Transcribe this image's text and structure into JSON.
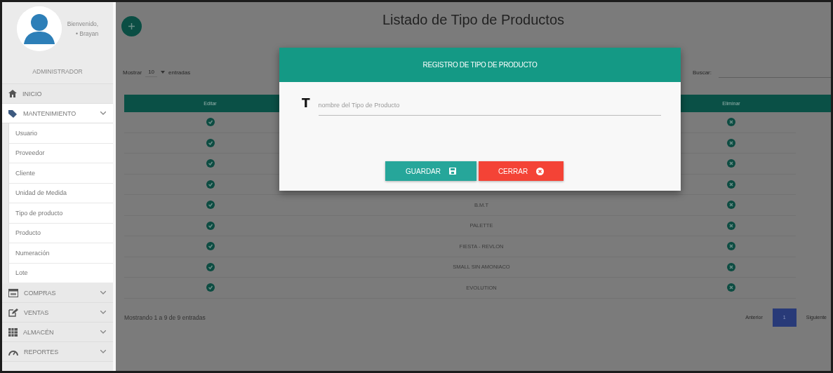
{
  "sidebar": {
    "greeting": "Bienvenido,",
    "user": "• Brayan",
    "role": "ADMINISTRADOR",
    "menu": [
      {
        "kind": "home",
        "label": "INICIO",
        "expanded": false
      },
      {
        "kind": "group",
        "label": "MANTENIMIENTO",
        "expanded": true,
        "children": [
          {
            "label": "Usuario"
          },
          {
            "label": "Proveedor"
          },
          {
            "label": "Cliente"
          },
          {
            "label": "Unidad de Medida"
          },
          {
            "label": "Tipo de producto"
          },
          {
            "label": "Producto"
          },
          {
            "label": "Numeración"
          },
          {
            "label": "Lote"
          }
        ]
      },
      {
        "kind": "group",
        "label": "COMPRAS",
        "expanded": false
      },
      {
        "kind": "group",
        "label": "VENTAS",
        "expanded": false
      },
      {
        "kind": "group",
        "label": "ALMACÉN",
        "expanded": false
      },
      {
        "kind": "group",
        "label": "REPORTES",
        "expanded": false
      }
    ]
  },
  "main": {
    "title": "Listado de Tipo de Productos",
    "length_label": "Mostrar",
    "length_value": "10",
    "length_suffix": "entradas",
    "search_label": "Buscar:",
    "table": {
      "columns": [
        "Editar",
        "Eliminar"
      ],
      "rows": [
        {},
        {},
        {},
        {},
        {
          "name": "B.M.T"
        },
        {
          "name": "PALETTE"
        },
        {
          "name": "FIESTA - REVLON"
        },
        {
          "name": "SMALL SIN AMONIACO"
        },
        {
          "name": "EVOLUTION"
        }
      ]
    },
    "info": "Mostrando 1 a 9 de 9 entradas",
    "pagination": {
      "previous": "Anterior",
      "pages": [
        {
          "label": "1",
          "selected": true
        }
      ],
      "next": "Siguiente"
    }
  },
  "modal": {
    "title": "REGISTRO DE TIPO DE PRODUCTO",
    "field_icon": "T",
    "placeholder": "nombre del Tipo de Producto",
    "buttons": [
      {
        "kind": "save",
        "label": "GUARDAR"
      },
      {
        "kind": "close",
        "label": "CERRAR"
      }
    ]
  }
}
